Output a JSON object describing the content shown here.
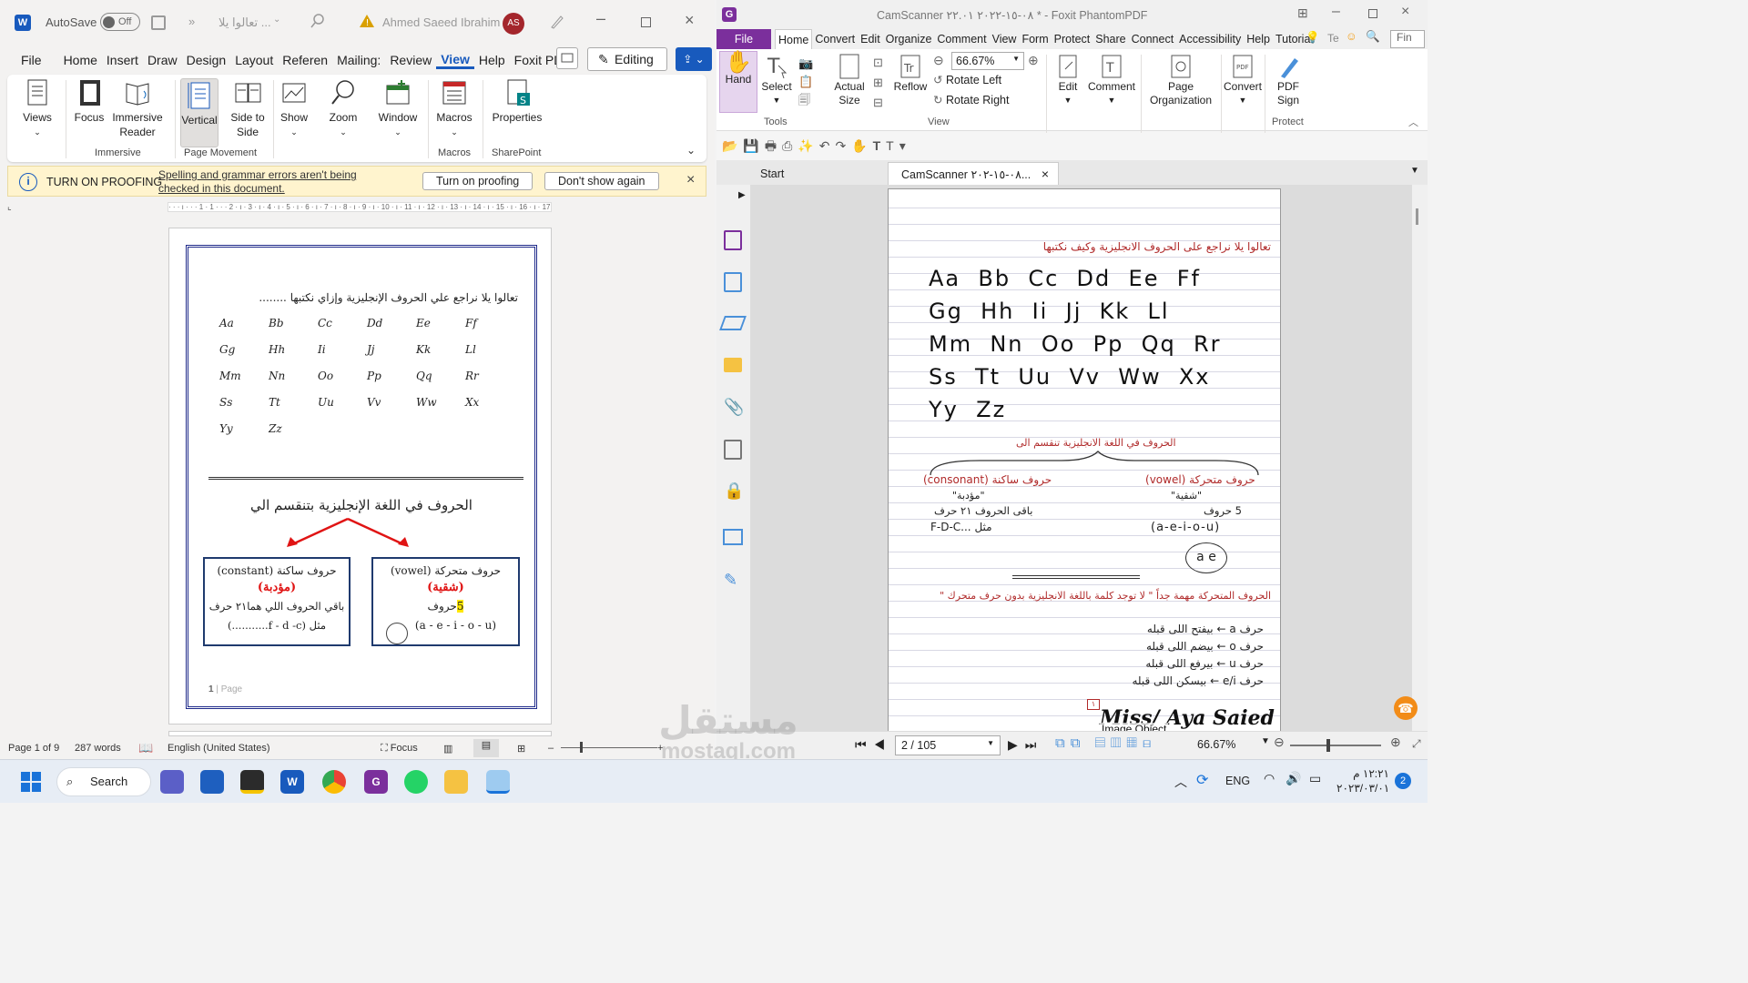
{
  "word": {
    "autosave_label": "AutoSave",
    "autosave_state": "Off",
    "doc_name": "تعالوا يلا ...",
    "user_name": "Ahmed Saeed Ibrahim",
    "user_initials": "AS",
    "tabs": [
      "File",
      "Home",
      "Insert",
      "Draw",
      "Design",
      "Layout",
      "Referen",
      "Mailing:",
      "Review",
      "View",
      "Help",
      "Foxit PD"
    ],
    "active_tab": "View",
    "editing_label": "Editing",
    "ribbon": {
      "views": "Views",
      "focus": "Focus",
      "immersive_reader": "Immersive Reader",
      "vertical": "Vertical",
      "side_to_side": "Side to Side",
      "show": "Show",
      "zoom": "Zoom",
      "window": "Window",
      "macros": "Macros",
      "properties": "Properties",
      "group_immersive": "Immersive",
      "group_page_movement": "Page Movement",
      "group_macros": "Macros",
      "group_sharepoint": "SharePoint"
    },
    "proofing": {
      "title": "TURN ON PROOFING",
      "message_line1": "Spelling and grammar errors aren't being",
      "message_line2": "checked in this document.",
      "turn_on": "Turn on proofing",
      "dont_show": "Don't show again"
    },
    "page": {
      "heading": "تعالوا يلا نراجع علي الحروف الإنجليزية وإزاي نكتبها ........",
      "letters": [
        [
          "Aa",
          "Bb",
          "Cc",
          "Dd",
          "Ee",
          "Ff"
        ],
        [
          "Gg",
          "Hh",
          "Ii",
          "Jj",
          "Kk",
          "Ll"
        ],
        [
          "Mm",
          "Nn",
          "Oo",
          "Pp",
          "Qq",
          "Rr"
        ],
        [
          "Ss",
          "Tt",
          "Uu",
          "Vv",
          "Ww",
          "Xx"
        ],
        [
          "Yy",
          "Zz"
        ]
      ],
      "subheading": "الحروف في اللغة الإنجليزية بتنقسم الي",
      "left_box": {
        "title": "حروف ساكنة (constant)",
        "name": "(مؤدبة)",
        "line1": "باقي الحروف اللي هما٢١ حرف",
        "line2": "مثل (f - d -c...........)"
      },
      "right_box": {
        "title": "حروف متحركة (vowel)",
        "name": "(شقية)",
        "count": "5",
        "count_suffix": "حروف",
        "line2": "(a - e - i - o - u)"
      },
      "footer_num": "1",
      "footer_label": "Page"
    },
    "status": {
      "page": "Page 1 of 9",
      "words": "287 words",
      "language": "English (United States)",
      "focus": "Focus"
    }
  },
  "foxit": {
    "window_title": "CamScanner ٠٨-١٥-٢٠٢٢ ٢٢.٠١ * - Foxit PhantomPDF",
    "menu": [
      "File",
      "Home",
      "Convert",
      "Edit",
      "Organize",
      "Comment",
      "View",
      "Form",
      "Protect",
      "Share",
      "Connect",
      "Accessibility",
      "Help",
      "Tutorial"
    ],
    "search_placeholder": "Fin",
    "tell_label": "Te",
    "ribbon": {
      "hand": "Hand",
      "select": "Select",
      "actual_size": "Actual Size",
      "reflow": "Reflow",
      "zoom_value": "66.67%",
      "rotate_left": "Rotate Left",
      "rotate_right": "Rotate Right",
      "edit": "Edit",
      "comment": "Comment",
      "page_organization": "Page Organization",
      "convert": "Convert",
      "pdf_sign": "PDF Sign",
      "group_tools": "Tools",
      "group_view": "View",
      "group_protect": "Protect"
    },
    "tabs": [
      "Start",
      "CamScanner ٠٨-١٥-٢٠٢..."
    ],
    "doc": {
      "heading": "تعالوا يلا نراجع على الحروف الانجليزية وكيف نكتبها",
      "rows": [
        "Aa  Bb  Cc  Dd  Ee  Ff",
        "Gg  Hh  Ii  Jj  Kk  Ll",
        "Mm  Nn  Oo  Pp  Qq  Rr",
        "Ss  Tt  Uu  Vv  Ww  Xx",
        "Yy  Zz"
      ],
      "split_line": "الحروف في اللغة الانجليزية تنقسم الى",
      "left_title": "(consonant) حروف ساكنة",
      "left_name": "\"مؤدبة\"",
      "left_line": "باقى الحروف ٢١ حرف",
      "left_example": "F-D-C... مثل",
      "right_title": "حروف متحركة (vowel)",
      "right_name": "\"شقية\"",
      "right_count": "5 حروف",
      "right_example": "(a-e-i-o-u)",
      "circle_label": "a e",
      "note": "الحروف المتحركة مهمة جداً \" لا توجد كلمة باللغة الانجليزية بدون حرف متحرك \"",
      "rules": [
        "حرف a ← بيفتح اللى قبله",
        "حرف o ← بيضم اللى قبله",
        "حرف u ← بيرفع اللى قبله",
        "حرف e/i ← بيسكن اللى قبله"
      ],
      "signature": "Miss/ Aya Saied",
      "image_object": "Image Object"
    },
    "status": {
      "page_field": "2 / 105",
      "zoom": "66.67%"
    }
  },
  "taskbar": {
    "search": "Search",
    "lang": "ENG",
    "time": "١٢:٢١ م",
    "date": "٢٠٢٣/٠٣/٠١",
    "badge": "2"
  },
  "watermark": {
    "text1": "مستقل",
    "text2": "mostaql.com"
  }
}
